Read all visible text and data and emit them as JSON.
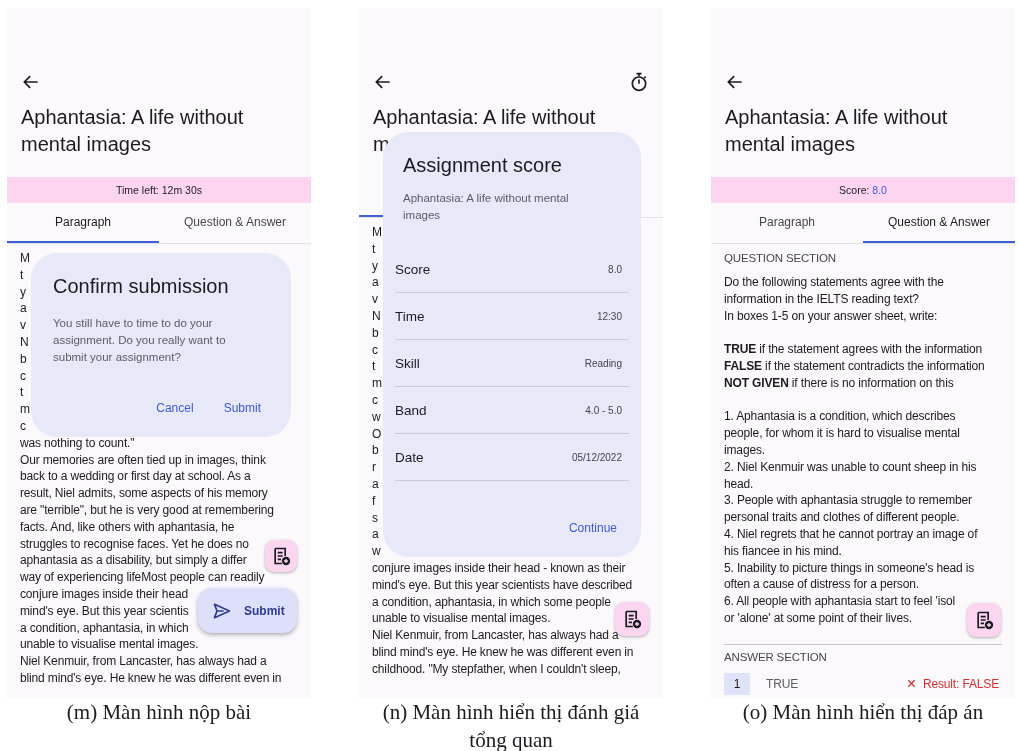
{
  "panels": [
    {
      "title_lines": [
        "Aphantasia: A life without",
        "mental images"
      ],
      "banner": {
        "label": "Time left: 12m 30s"
      },
      "tabs": [
        {
          "label": "Paragraph",
          "selected": true
        },
        {
          "label": "Question & Answer",
          "selected": false
        }
      ],
      "content": {
        "kind": "passage",
        "lines": [
          "M",
          "t",
          "y",
          "a",
          "v",
          "N",
          "b",
          "c",
          "t",
          "m",
          "c",
          "was nothing to count.\"",
          "Our memories are often tied up in images, think",
          "back to a wedding or first day at school. As a",
          "result, Niel admits, some aspects of his memory",
          "are \"terrible\", but he is very good at remembering",
          "facts. And, like others with aphantasia, he",
          "struggles to recognise faces. Yet he does no",
          "aphantasia as a disability, but simply a differ",
          "way of experiencing lifeMost people can readily",
          "conjure images inside their head",
          "mind's eye. But this year scientis",
          "a condition, aphantasia, in which",
          "unable to visualise mental images.",
          "Niel Kenmuir, from Lancaster, has always had a",
          "blind mind's eye. He knew he was different even in"
        ]
      },
      "dialog": {
        "kind": "confirm",
        "title": "Confirm submission",
        "body": "You still have to time to do your assignment. Do you really want to submit your assignment?",
        "buttons": [
          "Cancel",
          "Submit"
        ]
      },
      "fabs": [
        {
          "kind": "icon"
        },
        {
          "kind": "extended",
          "label": "Submit"
        }
      ],
      "caption": "(m) Màn hình nộp bài"
    },
    {
      "title_lines": [
        "Aphantasia: A life without",
        "m"
      ],
      "timer_icon": true,
      "tabs": [
        {
          "selected": true
        },
        {
          "selected": false
        }
      ],
      "content": {
        "kind": "passage",
        "lines": [
          "M",
          "t",
          "y",
          "a",
          "v",
          "N",
          "b",
          "c",
          "t",
          "m",
          "c",
          "w",
          "O",
          "b",
          "r",
          "a",
          "f",
          "s",
          "a",
          "w",
          "conjure images inside their head - known as their",
          "mind's eye. But this year scientists have described",
          "a condition, aphantasia, in which some people",
          "unable to visualise mental images.",
          "Niel Kenmuir, from Lancaster, has always had a",
          "blind mind's eye. He knew he was different even in",
          "childhood. \"My stepfather, when I couldn't sleep,"
        ]
      },
      "dialog": {
        "kind": "score",
        "title": "Assignment score",
        "subtitle": "Aphantasia: A life without mental images",
        "rows": [
          {
            "label": "Score",
            "value": "8.0"
          },
          {
            "label": "Time",
            "value": "12:30"
          },
          {
            "label": "Skill",
            "value": "Reading"
          },
          {
            "label": "Band",
            "value": "4.0 - 5.0"
          },
          {
            "label": "Date",
            "value": "05/12/2022"
          }
        ],
        "buttons": [
          "Continue"
        ]
      },
      "fabs": [
        {
          "kind": "icon"
        }
      ],
      "caption": "(n) Màn hình hiển thị đánh giá tổng quan"
    },
    {
      "title_lines": [
        "Aphantasia: A life without",
        "mental images"
      ],
      "banner": {
        "label": "Score:",
        "value": "8.0"
      },
      "tabs": [
        {
          "label": "Paragraph",
          "selected": false
        },
        {
          "label": "Question & Answer",
          "selected": true
        }
      ],
      "content": {
        "kind": "questions",
        "heading": "QUESTION SECTION",
        "groups": [
          [
            "Do the following statements agree with the",
            "information in the IELTS reading text?",
            "In  boxes 1-5 on your answer sheet, write:"
          ],
          [
            "**TRUE** if the statement agrees with the information",
            "**FALSE** if the statement contradicts the information",
            "**NOT GIVEN** if there is no information on this"
          ],
          [
            "1. Aphantasia is a condition, which describes",
            "people, for whom it is hard to visualise mental",
            "images.",
            "2. Niel Kenmuir was unable to count sheep in his",
            "head.",
            "3. People with aphantasia struggle to remember",
            "personal traits and clothes of different people.",
            "4. Niel regrets that he cannot portray an image of",
            "his fiancee in his mind.",
            "5. Inability to picture things in someone's head is",
            "often a cause of distress for a person.",
            "6. All people with aphantasia start to feel 'isol",
            "or 'alone' at some point of their lives."
          ]
        ],
        "answer_heading": "ANSWER SECTION",
        "answers": [
          {
            "number": "1",
            "answer": "TRUE",
            "result": "Result: FALSE",
            "correct": false
          }
        ]
      },
      "fabs": [
        {
          "kind": "icon"
        }
      ],
      "caption": "(o) Màn hình hiển thị đáp án"
    }
  ]
}
